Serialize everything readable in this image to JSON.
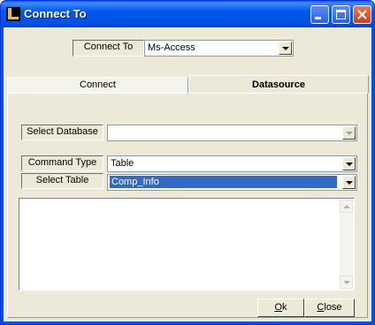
{
  "window": {
    "title": "Connect To"
  },
  "connect_to": {
    "label": "Connect To",
    "value": "Ms-Access"
  },
  "tabs": [
    {
      "label": "Connect",
      "active": false
    },
    {
      "label": "Datasource",
      "active": true
    }
  ],
  "fields": {
    "select_database": {
      "label": "Select Database",
      "value": ""
    },
    "command_type": {
      "label": "Command Type",
      "value": "Table"
    },
    "select_table": {
      "label": "Select Table",
      "value": "Comp_Info"
    }
  },
  "sql_text": "",
  "buttons": {
    "ok": {
      "mnemonic": "O",
      "rest": "k"
    },
    "close": {
      "mnemonic": "C",
      "rest": "lose"
    }
  }
}
